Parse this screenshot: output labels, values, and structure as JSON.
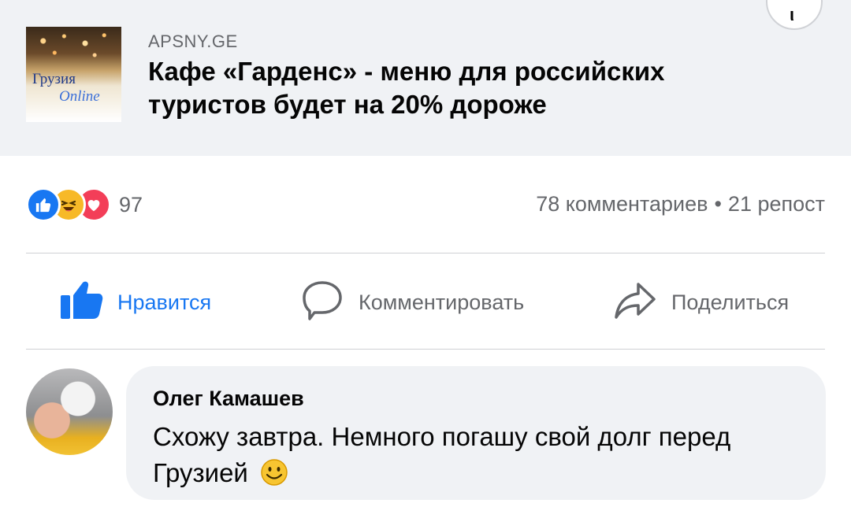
{
  "link_preview": {
    "thumbnail_title": "Грузия",
    "thumbnail_subtitle": "Online",
    "domain": "APSNY.GE",
    "headline": "Кафе «Гарденс» - меню для российских туристов будет на 20% дороже",
    "corner_icon": "menu-icon"
  },
  "reactions": {
    "icons": [
      "like-icon",
      "haha-icon",
      "love-icon"
    ],
    "count": "97"
  },
  "stats": {
    "comments": "78 комментариев",
    "separator": "•",
    "shares": "21 репост"
  },
  "actions": {
    "like_label": "Нравится",
    "comment_label": "Комментировать",
    "share_label": "Поделиться"
  },
  "comment": {
    "author": "Олег Камашев",
    "text": "Схожу завтра. Немного погашу свой долг перед Грузией",
    "emoji": "smile-icon"
  },
  "colors": {
    "accent": "#1877f2",
    "secondary_text": "#65676b",
    "card_bg": "#f0f2f5"
  }
}
